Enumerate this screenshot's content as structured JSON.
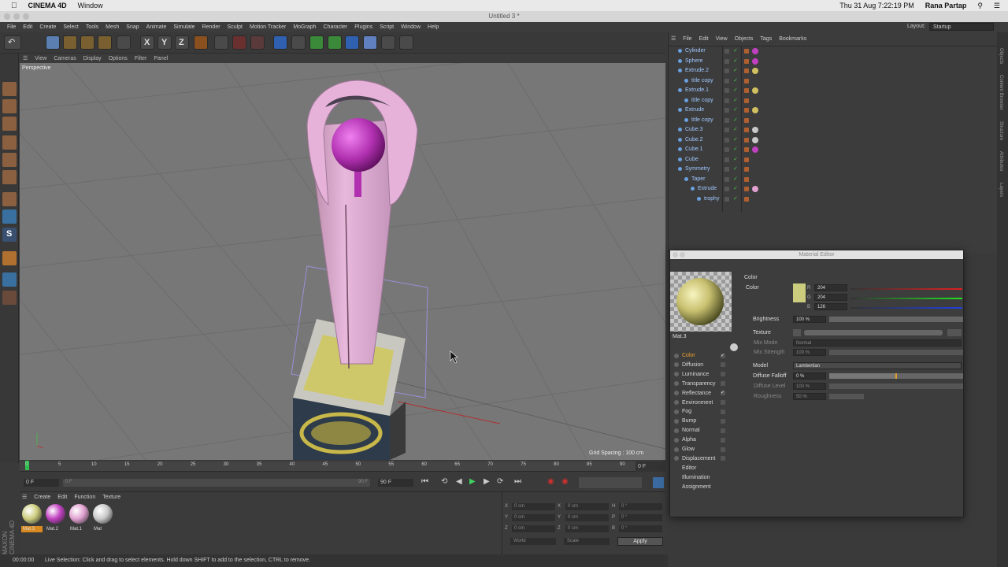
{
  "mac_menu": {
    "app": "CINEMA 4D",
    "window": "Window",
    "datetime": "Thu 31 Aug  7:22:19 PM",
    "user": "Rana Partap"
  },
  "window_title": "Untitled 3 *",
  "menu": [
    "File",
    "Edit",
    "Create",
    "Select",
    "Tools",
    "Mesh",
    "Snap",
    "Animate",
    "Simulate",
    "Render",
    "Sculpt",
    "Motion Tracker",
    "MoGraph",
    "Character",
    "Plugins",
    "Script",
    "Window",
    "Help"
  ],
  "layout": {
    "label": "Layout:",
    "value": "Startup"
  },
  "viewport": {
    "menu": [
      "View",
      "Cameras",
      "Display",
      "Options",
      "Filter",
      "Panel"
    ],
    "camera_label": "Perspective",
    "grid_spacing": "Grid Spacing : 100 cm"
  },
  "timeline": {
    "ticks": [
      "0",
      "5",
      "10",
      "15",
      "20",
      "25",
      "30",
      "35",
      "40",
      "45",
      "50",
      "55",
      "60",
      "65",
      "70",
      "75",
      "80",
      "85",
      "90"
    ],
    "current_frame": "0 F",
    "start_field": "0 F",
    "end_field": "90 F",
    "end_field_2": "90 F",
    "right_field": "0 F"
  },
  "material_manager": {
    "menu": [
      "Create",
      "Edit",
      "Function",
      "Texture"
    ],
    "materials": [
      {
        "name": "Mat.3",
        "color": "#cccc7e",
        "selected": true
      },
      {
        "name": "Mat.2",
        "color": "#c040c0",
        "selected": false
      },
      {
        "name": "Mat.1",
        "color": "#e0a0d0",
        "selected": false
      },
      {
        "name": "Mat",
        "color": "#c8c8c8",
        "selected": false
      }
    ]
  },
  "coordinates": {
    "rows": [
      {
        "a": "X",
        "av": "0 cm",
        "b": "X",
        "bv": "0 cm",
        "c": "H",
        "cv": "0 °"
      },
      {
        "a": "Y",
        "av": "0 cm",
        "b": "Y",
        "bv": "0 cm",
        "c": "P",
        "cv": "0 °"
      },
      {
        "a": "Z",
        "av": "0 cm",
        "b": "Z",
        "bv": "0 cm",
        "c": "B",
        "cv": "0 °"
      }
    ],
    "world": "World",
    "scale": "Scale",
    "apply": "Apply"
  },
  "status": {
    "time": "00:00:00",
    "message": "Live Selection: Click and drag to select elements. Hold down SHIFT to add to the selection, CTRL to remove."
  },
  "object_manager": {
    "menu": [
      "File",
      "Edit",
      "View",
      "Objects",
      "Tags",
      "Bookmarks"
    ],
    "objects": [
      {
        "name": "Cylinder",
        "indent": 0
      },
      {
        "name": "Sphere",
        "indent": 0
      },
      {
        "name": "Extrude.2",
        "indent": 0
      },
      {
        "name": "title copy",
        "indent": 1
      },
      {
        "name": "Extrude.1",
        "indent": 0
      },
      {
        "name": "title copy",
        "indent": 1
      },
      {
        "name": "Extrude",
        "indent": 0
      },
      {
        "name": "title copy",
        "indent": 1
      },
      {
        "name": "Cube.3",
        "indent": 0
      },
      {
        "name": "Cube.2",
        "indent": 0
      },
      {
        "name": "Cube.1",
        "indent": 0
      },
      {
        "name": "Cube",
        "indent": 0
      },
      {
        "name": "Symmetry",
        "indent": 0
      },
      {
        "name": "Taper",
        "indent": 1
      },
      {
        "name": "Extrude",
        "indent": 2
      },
      {
        "name": "trophy",
        "indent": 3
      }
    ]
  },
  "material_editor": {
    "title": "Material Editor",
    "material_name": "Mat.3",
    "channels": [
      {
        "name": "Color",
        "checked": true,
        "active": true
      },
      {
        "name": "Diffusion",
        "checked": false
      },
      {
        "name": "Luminance",
        "checked": false
      },
      {
        "name": "Transparency",
        "checked": false
      },
      {
        "name": "Reflectance",
        "checked": true
      },
      {
        "name": "Environment",
        "checked": false
      },
      {
        "name": "Fog",
        "checked": false
      },
      {
        "name": "Bump",
        "checked": false
      },
      {
        "name": "Normal",
        "checked": false
      },
      {
        "name": "Alpha",
        "checked": false
      },
      {
        "name": "Glow",
        "checked": false
      },
      {
        "name": "Displacement",
        "checked": false
      },
      {
        "name": "Editor"
      },
      {
        "name": "Illumination"
      },
      {
        "name": "Assignment"
      }
    ],
    "section": "Color",
    "color_label": "Color",
    "r": "204",
    "g": "204",
    "b": "126",
    "r_label": "R",
    "g_label": "G",
    "b_label": "B",
    "brightness_label": "Brightness",
    "brightness": "100 %",
    "texture_label": "Texture",
    "mix_mode_label": "Mix Mode",
    "mix_mode": "Normal",
    "mix_strength_label": "Mix Strength",
    "mix_strength": "100 %",
    "model_label": "Model",
    "model": "Lambertian",
    "diffuse_falloff_label": "Diffuse Falloff",
    "diffuse_falloff": "0 %",
    "diffuse_level_label": "Diffuse Level",
    "diffuse_level": "100 %",
    "roughness_label": "Roughness",
    "roughness": "50 %",
    "swatch_color": "#cccc7e"
  },
  "side_tabs": [
    "Objects",
    "Content Browser",
    "Structure",
    "Attributes",
    "Layers"
  ]
}
